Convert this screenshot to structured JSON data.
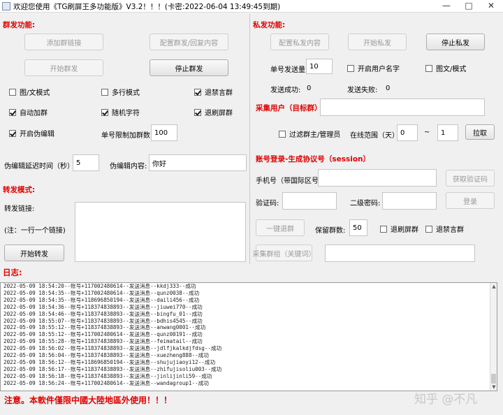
{
  "window": {
    "title": "欢迎您使用《TG刷屏王多功能版》V3.2！！！(卡密:2022-06-04 13:49:45到期)",
    "minimize": "—",
    "maximize": "□",
    "close": "✕"
  },
  "group": {
    "section_title": "群发功能:",
    "add_link_btn": "添加群链接",
    "config_btn": "配置群发/回复内容",
    "start_btn": "开始群发",
    "stop_btn": "停止群发",
    "opt_image_text": "图/文模式",
    "opt_multiline": "多行模式",
    "opt_leave_muted": "退禁言群",
    "opt_auto_join": "自动加群",
    "opt_random_char": "随机字符",
    "opt_leave_spam": "退刷屏群",
    "opt_pseudo_edit": "开启伪编辑",
    "join_limit_label": "单号限制加群数:",
    "join_limit_value": "100",
    "delay_label": "伪编辑延迟时间（秒）:",
    "delay_value": "5",
    "edit_content_label": "伪编辑内容:",
    "edit_content_value": "你好"
  },
  "forward": {
    "section_title": "转发模式:",
    "link_label": "转发链接:",
    "note": "(注：一行一个链接)",
    "start_btn": "开始转发"
  },
  "private": {
    "section_title": "私发功能:",
    "config_btn": "配置私发内容",
    "start_btn": "开始私发",
    "stop_btn": "停止私发",
    "send_count_label": "单号发送量:",
    "send_count_value": "10",
    "opt_username": "开启用户名字",
    "opt_image_text": "图文/模式",
    "success_label": "发送成功:",
    "success_value": "0",
    "fail_label": "发送失败:",
    "fail_value": "0"
  },
  "collect": {
    "section_title": "采集用户（目标群）",
    "opt_filter": "过滤群主/管理员",
    "online_label": "在线范围（天）",
    "range_from": "0",
    "range_sep": "~",
    "range_to": "1",
    "pull_btn": "拉取"
  },
  "login": {
    "section_title": "账号登录-生成协议号（session）",
    "phone_label": "手机号（带国际区号）",
    "get_code_btn": "获取验证码",
    "code_label": "验证码:",
    "pwd_label": "二级密码:",
    "login_btn": "登录",
    "leave_btn": "一键退群",
    "keep_label": "保留群数:",
    "keep_value": "50",
    "opt_leave_spam": "退刷屏群",
    "opt_leave_muted": "退禁言群",
    "collect_btn": "采集群组（关键词）"
  },
  "log": {
    "title": "日志:",
    "lines": [
      "2022-05-09 18:54:20--账号+117002480614--发送消息--kkdj333--成功",
      "2022-05-09 18:54:35--账号+117002480614--发送消息--qunz0038--成功",
      "2022-05-09 18:54:35--账号+118696850194--发送消息--daili456--成功",
      "2022-05-09 18:54:36--账号+118374838893--发送消息--jiuwei770--成功",
      "2022-05-09 18:54:46--账号+118374838893--发送消息--bingfu_01--成功",
      "2022-05-09 18:55:07--账号+118374838893--发送消息--bdhis4545--成功",
      "2022-05-09 18:55:12--账号+118374838893--发送消息--anwang0001--成功",
      "2022-05-09 18:55:12--账号+117002480614--发送消息--qunz00191--成功",
      "2022-05-09 18:55:28--账号+118374838893--发送消息--feimatail--成功",
      "2022-05-09 18:56:02--账号+118374838893--发送消息--jdlfjkalkdjfdsg--成功",
      "2022-05-09 18:56:04--账号+118374838893--发送消息--xuezheng888--成功",
      "2022-05-09 18:56:12--账号+118696850194--发送消息--shujujiaoyi12--成功",
      "2022-05-09 18:56:17--账号+118374838893--发送消息--zhifujisoliu003--成功",
      "2022-05-09 18:56:18--账号+118374838893--发送消息--jinlijinli59--成功",
      "2022-05-09 18:56:24--账号+117002480614--发送消息--wandagroup1--成功"
    ]
  },
  "footer": {
    "warning": "注意。本軟件僅限中國大陸地區外使用！！！",
    "watermark": "知乎 @不凡"
  }
}
